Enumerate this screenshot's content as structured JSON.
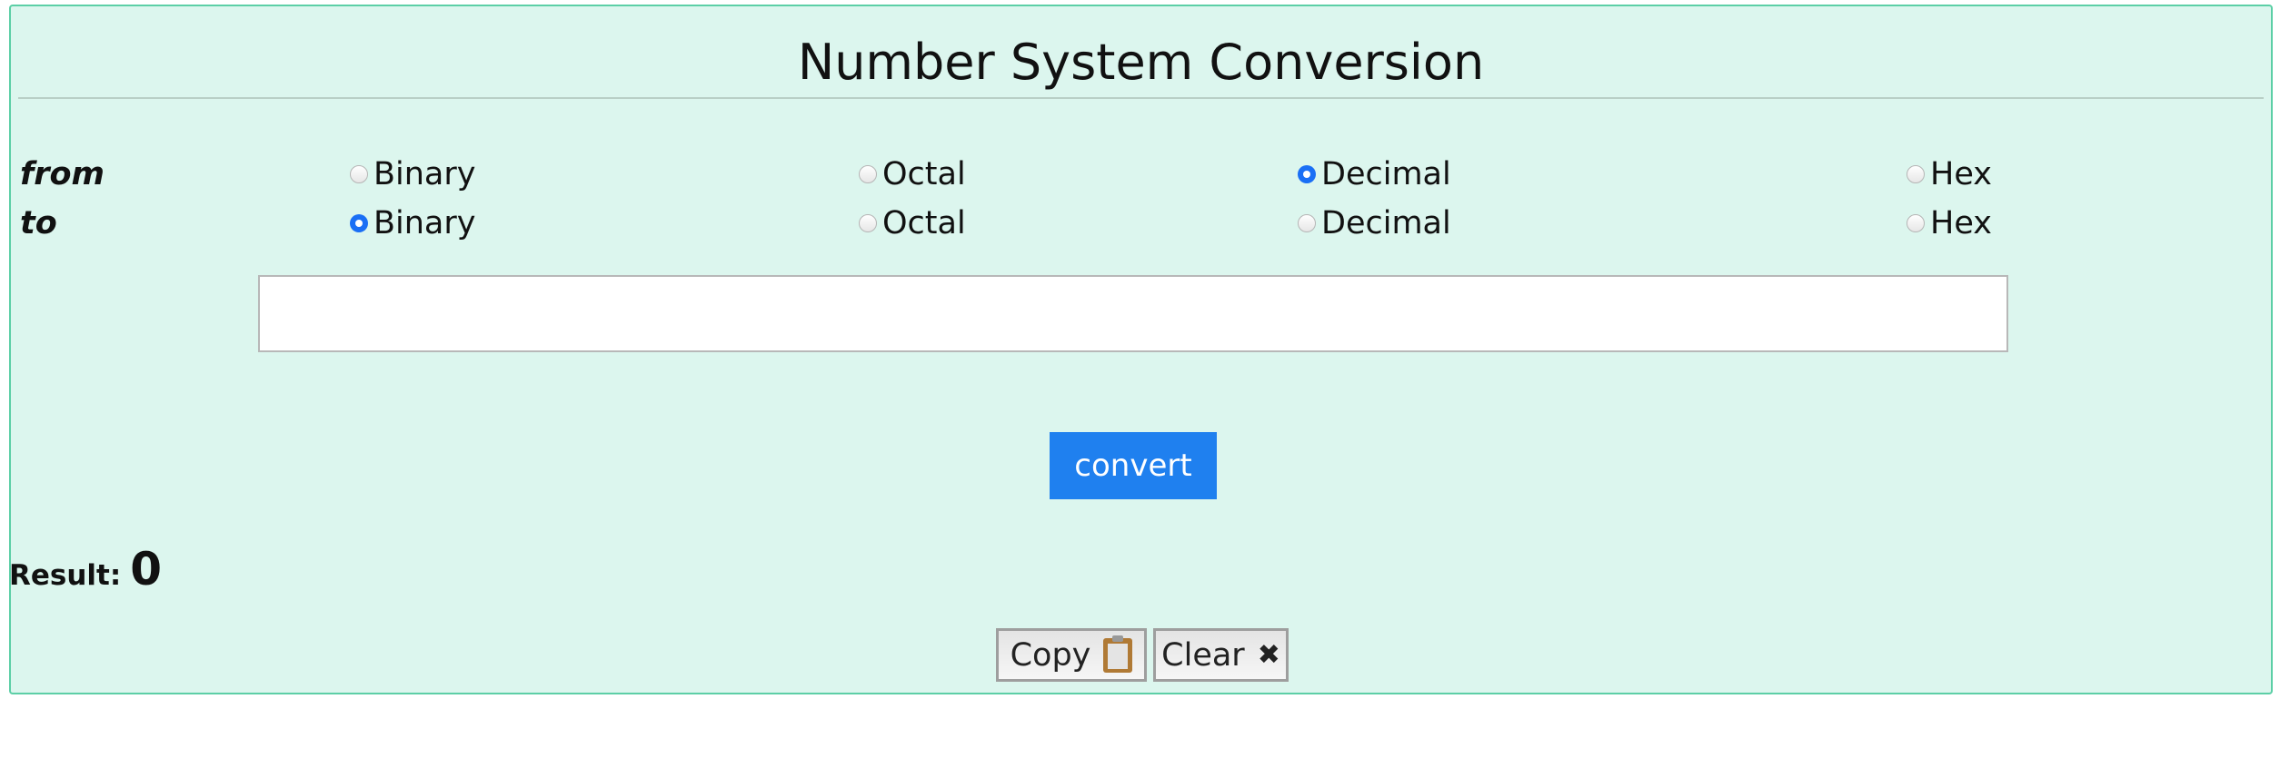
{
  "title": "Number System Conversion",
  "from": {
    "label": "from",
    "options": [
      "Binary",
      "Octal",
      "Decimal",
      "Hex"
    ],
    "selected": "Decimal"
  },
  "to": {
    "label": "to",
    "options": [
      "Binary",
      "Octal",
      "Decimal",
      "Hex"
    ],
    "selected": "Binary"
  },
  "input": {
    "value": "",
    "placeholder": ""
  },
  "convert_label": "convert",
  "result": {
    "label": "Result:",
    "value": "0"
  },
  "copy_label": "Copy",
  "clear_label": "Clear",
  "clear_icon": "✖",
  "colors": {
    "accent": "#1f80ef",
    "panel": "#dcf6ee",
    "border": "#5ccfa6"
  }
}
